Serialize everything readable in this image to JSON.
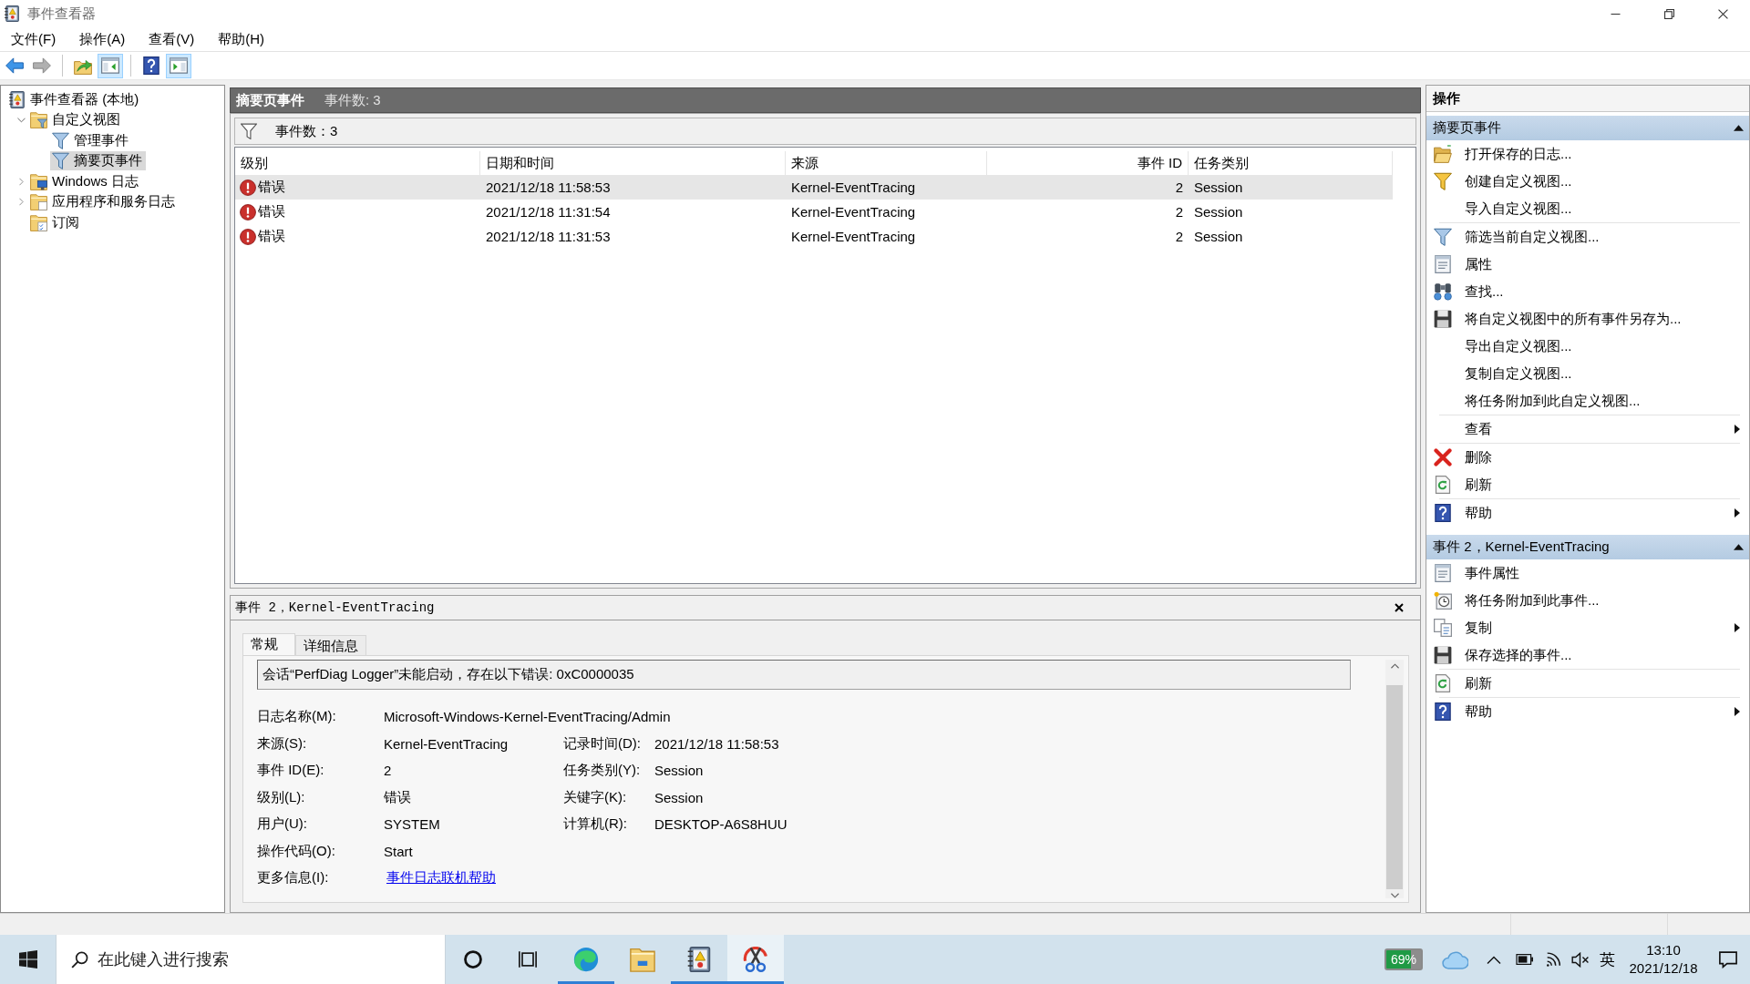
{
  "window": {
    "title": "事件查看器"
  },
  "menu": [
    "文件(F)",
    "操作(A)",
    "查看(V)",
    "帮助(H)"
  ],
  "toolbar": [
    [
      {
        "kind": "back",
        "on": false,
        "disabled": false
      },
      {
        "kind": "forward",
        "on": false,
        "disabled": true
      }
    ],
    [
      {
        "kind": "up",
        "on": false,
        "disabled": false
      },
      {
        "kind": "tree-pane",
        "on": true,
        "disabled": false
      }
    ],
    [
      {
        "kind": "help",
        "on": false,
        "disabled": false
      },
      {
        "kind": "action-pane",
        "on": true,
        "disabled": false
      }
    ]
  ],
  "tree": [
    {
      "label": "事件查看器 (本地)",
      "kind": "root",
      "expandable": false,
      "selected": false,
      "children": [
        {
          "label": "自定义视图",
          "kind": "view-folder",
          "expandable": true,
          "expanded": true,
          "selected": false,
          "children": [
            {
              "label": "管理事件",
              "kind": "view",
              "expandable": false,
              "selected": false
            },
            {
              "label": "摘要页事件",
              "kind": "view",
              "expandable": false,
              "selected": true
            }
          ]
        },
        {
          "label": "Windows 日志",
          "kind": "log-folder",
          "expandable": true,
          "expanded": false,
          "selected": false
        },
        {
          "label": "应用程序和服务日志",
          "kind": "folder",
          "expandable": true,
          "expanded": false,
          "selected": false
        },
        {
          "label": "订阅",
          "kind": "subscriptions",
          "expandable": false,
          "selected": false
        }
      ]
    }
  ],
  "summary_header": {
    "title": "摘要页事件",
    "count": "事件数: 3"
  },
  "filter_bar": {
    "count": "事件数：3"
  },
  "table": {
    "columns": [
      "级别",
      "日期和时间",
      "来源",
      "事件 ID",
      "任务类别"
    ],
    "rows": [
      {
        "kind": "error",
        "selected": true,
        "cells": [
          "错误",
          "2021/12/18 11:58:53",
          "Kernel-EventTracing",
          "2",
          "Session"
        ]
      },
      {
        "kind": "error",
        "selected": false,
        "cells": [
          "错误",
          "2021/12/18 11:31:54",
          "Kernel-EventTracing",
          "2",
          "Session"
        ]
      },
      {
        "kind": "error",
        "selected": false,
        "cells": [
          "错误",
          "2021/12/18 11:31:53",
          "Kernel-EventTracing",
          "2",
          "Session"
        ]
      }
    ]
  },
  "detail": {
    "title": "事件 2，Kernel-EventTracing",
    "tabs": [
      {
        "label": "常规",
        "selected": true
      },
      {
        "label": "详细信息",
        "selected": false
      }
    ],
    "message": "会话“PerfDiag Logger”未能启动，存在以下错误: 0xC0000035",
    "fields": [
      [
        {
          "label": "日志名称(M):",
          "value": "Microsoft-Windows-Kernel-EventTracing/Admin",
          "kind": "text"
        }
      ],
      [
        {
          "label": "来源(S):",
          "value": "Kernel-EventTracing",
          "kind": "text"
        },
        {
          "label": "记录时间(D):",
          "value": "2021/12/18 11:58:53",
          "kind": "text"
        }
      ],
      [
        {
          "label": "事件 ID(E):",
          "value": "2",
          "kind": "text"
        },
        {
          "label": "任务类别(Y):",
          "value": "Session",
          "kind": "text"
        }
      ],
      [
        {
          "label": "级别(L):",
          "value": "错误",
          "kind": "text"
        },
        {
          "label": "关键字(K):",
          "value": "Session",
          "kind": "text"
        }
      ],
      [
        {
          "label": "用户(U):",
          "value": "SYSTEM",
          "kind": "text"
        },
        {
          "label": "计算机(R):",
          "value": "DESKTOP-A6S8HUU",
          "kind": "text"
        }
      ],
      [
        {
          "label": "操作代码(O):",
          "value": "Start",
          "kind": "text"
        }
      ],
      [
        {
          "label": "更多信息(I):",
          "value": "事件日志联机帮助",
          "kind": "link"
        }
      ]
    ]
  },
  "actions": {
    "title": "操作",
    "sections": [
      {
        "title": "摘要页事件",
        "expanded": true,
        "groups": [
          [
            {
              "label": "打开保存的日志...",
              "kind": "open-log",
              "submenu": false
            },
            {
              "label": "创建自定义视图...",
              "kind": "create-view",
              "submenu": false
            },
            {
              "label": "导入自定义视图...",
              "kind": "none",
              "submenu": false
            }
          ],
          [
            {
              "label": "筛选当前自定义视图...",
              "kind": "filter",
              "submenu": false
            },
            {
              "label": "属性",
              "kind": "properties",
              "submenu": false
            },
            {
              "label": "查找...",
              "kind": "find",
              "submenu": false
            },
            {
              "label": "将自定义视图中的所有事件另存为...",
              "kind": "save",
              "submenu": false
            },
            {
              "label": "导出自定义视图...",
              "kind": "none",
              "submenu": false
            },
            {
              "label": "复制自定义视图...",
              "kind": "none",
              "submenu": false
            },
            {
              "label": "将任务附加到此自定义视图...",
              "kind": "none",
              "submenu": false
            }
          ],
          [
            {
              "label": "查看",
              "kind": "none",
              "submenu": true
            }
          ],
          [
            {
              "label": "删除",
              "kind": "delete",
              "submenu": false
            },
            {
              "label": "刷新",
              "kind": "refresh",
              "submenu": false
            }
          ],
          [
            {
              "label": "帮助",
              "kind": "help",
              "submenu": true
            }
          ]
        ]
      },
      {
        "title": "事件 2，Kernel-EventTracing",
        "expanded": true,
        "groups": [
          [
            {
              "label": "事件属性",
              "kind": "properties",
              "submenu": false
            },
            {
              "label": "将任务附加到此事件...",
              "kind": "attach-task",
              "submenu": false
            },
            {
              "label": "复制",
              "kind": "copy",
              "submenu": true
            },
            {
              "label": "保存选择的事件...",
              "kind": "save",
              "submenu": false
            }
          ],
          [
            {
              "label": "刷新",
              "kind": "refresh",
              "submenu": false
            }
          ],
          [
            {
              "label": "帮助",
              "kind": "help",
              "submenu": true
            }
          ]
        ]
      }
    ]
  },
  "taskbar": {
    "search": {
      "placeholder": "在此键入进行搜索"
    },
    "buttons": [
      {
        "kind": "cortana",
        "running": false,
        "active": false
      },
      {
        "kind": "task-view",
        "running": false,
        "active": false
      },
      {
        "kind": "browser",
        "running": true,
        "active": false
      },
      {
        "kind": "files",
        "running": false,
        "active": false
      },
      {
        "kind": "event-viewer",
        "running": true,
        "active": false
      },
      {
        "kind": "snipping",
        "running": true,
        "active": true
      }
    ],
    "tray": {
      "battery_badge": "69%",
      "ime": "英",
      "time": "13:10",
      "date": "2021/12/18"
    }
  }
}
